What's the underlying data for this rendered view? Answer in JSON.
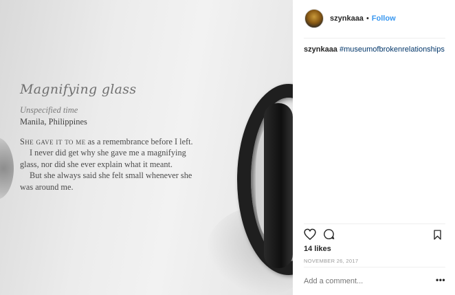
{
  "photo": {
    "title": "Magnifying glass",
    "subtitle": "Unspecified time",
    "location": "Manila, Philippines",
    "lead_smallcaps": "She gave it to me",
    "lead_rest": " as a remembrance before I left.",
    "paragraphs": [
      "I never did get why she gave me a magnifying glass, nor did she ever explain what it meant.",
      "But she always said she felt small whenever she was around me."
    ]
  },
  "post": {
    "username": "szynkaaa",
    "separator": "•",
    "follow_label": "Follow",
    "caption_user": "szynkaaa",
    "caption_hashtag": "#museumofbrokenrelationships",
    "likes": "14 likes",
    "date": "NOVEMBER 26, 2017",
    "comment_placeholder": "Add a comment...",
    "more_label": "•••"
  },
  "colors": {
    "link_blue": "#3897f0",
    "hashtag_navy": "#003569",
    "text_dark": "#262626",
    "muted_gray": "#999999"
  },
  "icons": [
    "heart-icon",
    "comment-icon",
    "bookmark-icon",
    "more-options-icon"
  ]
}
